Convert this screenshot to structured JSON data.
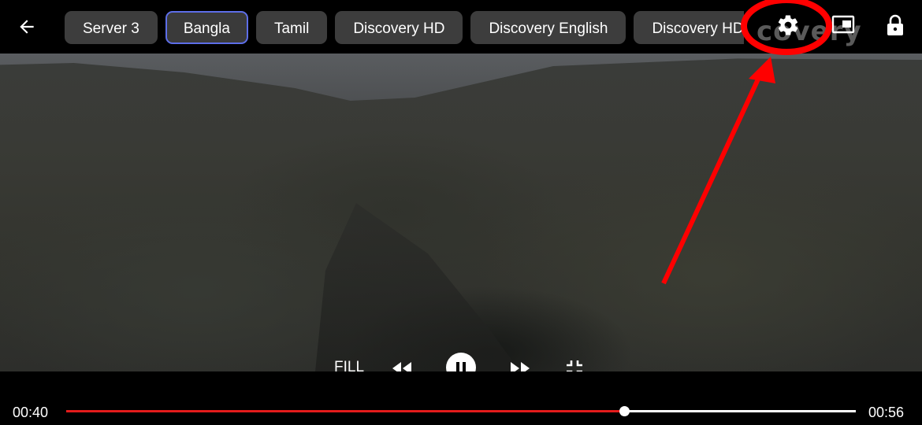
{
  "top_bar": {
    "tabs": [
      {
        "label": "Server 3",
        "selected": false
      },
      {
        "label": "Bangla",
        "selected": true
      },
      {
        "label": "Tamil",
        "selected": false
      },
      {
        "label": "Discovery HD",
        "selected": false
      },
      {
        "label": "Discovery English",
        "selected": false
      },
      {
        "label": "Discovery HD Bangla",
        "selected": false
      }
    ],
    "watermark": "covery",
    "icons": [
      "back-arrow-icon",
      "gear-icon",
      "picture-in-picture-icon",
      "lock-icon"
    ]
  },
  "controls": {
    "fill_label": "FILL",
    "icons": [
      "rewind-icon",
      "pause-icon",
      "fast-forward-icon",
      "exit-fullscreen-icon"
    ]
  },
  "playback": {
    "current_time": "00:40",
    "duration": "00:56",
    "progress_fraction": 0.707
  },
  "colors": {
    "accent": "#e31b1b",
    "chip_background": "#3d3d3d",
    "selected_chip_border": "#5d6ee8",
    "annotation": "#ff0000"
  }
}
